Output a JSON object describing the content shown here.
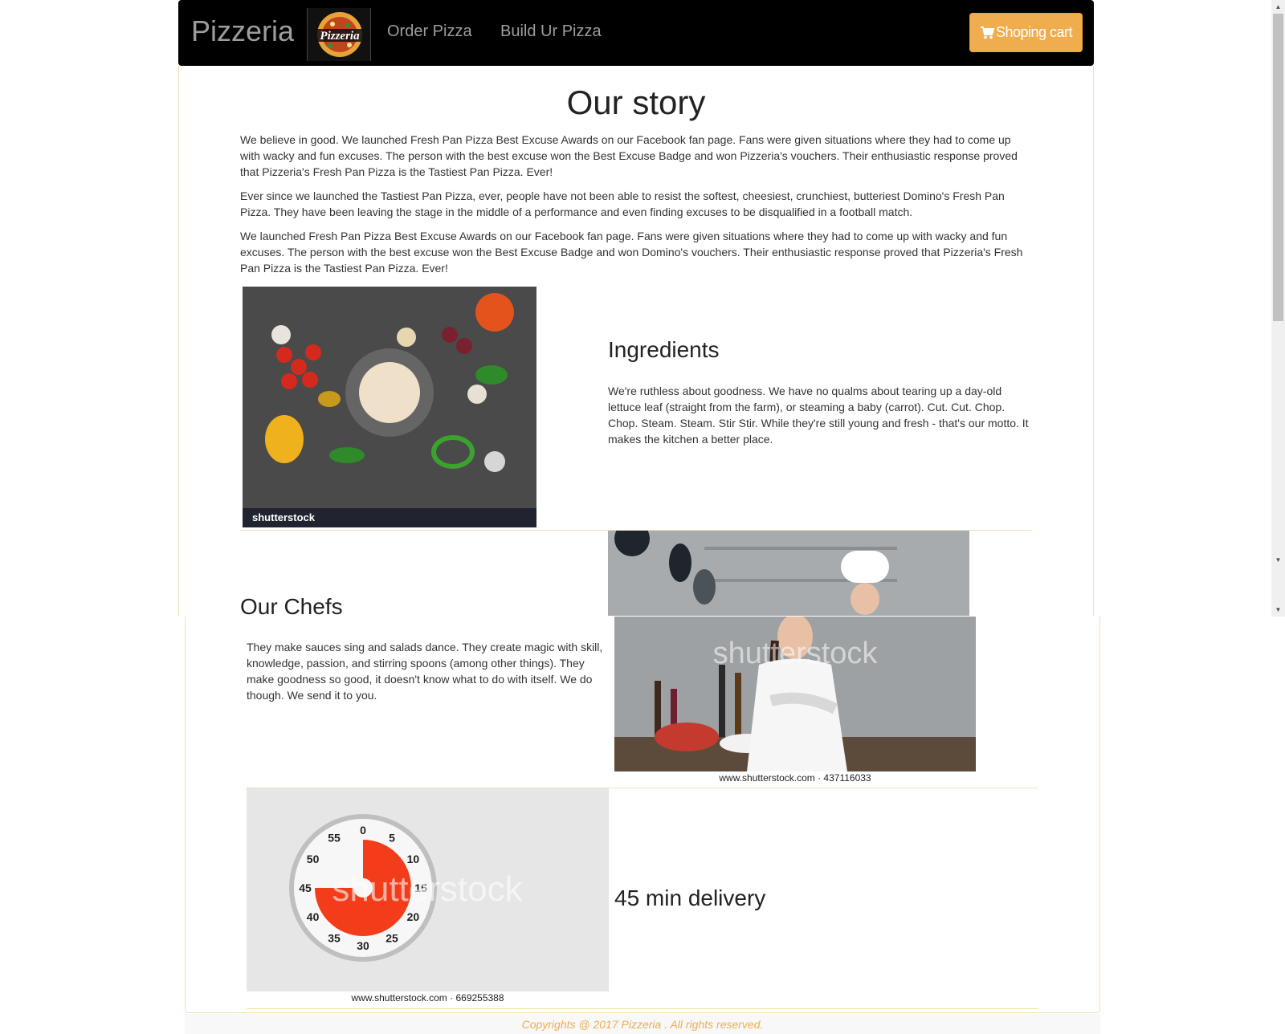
{
  "nav": {
    "brand": "Pizzeria",
    "logo_text": "Pizzeria",
    "links": [
      "Order Pizza",
      "Build Ur Pizza"
    ],
    "cart_label": "Shoping cart"
  },
  "story": {
    "title": "Our story",
    "paragraphs": [
      "We believe in good. We launched Fresh Pan Pizza Best Excuse Awards on our Facebook fan page. Fans were given situations where they had to come up with wacky and fun excuses. The person with the best excuse won the Best Excuse Badge and won Pizzeria's vouchers. Their enthusiastic response proved that Pizzeria's Fresh Pan Pizza is the Tastiest Pan Pizza. Ever!",
      "Ever since we launched the Tastiest Pan Pizza, ever, people have not been able to resist the softest, cheesiest, crunchiest, butteriest Domino's Fresh Pan Pizza. They have been leaving the stage in the middle of a performance and even finding excuses to be disqualified in a football match.",
      "We launched Fresh Pan Pizza Best Excuse Awards on our Facebook fan page. Fans were given situations where they had to come up with wacky and fun excuses. The person with the best excuse won the Best Excuse Badge and won Domino's vouchers. Their enthusiastic response proved that Pizzeria's Fresh Pan Pizza is the Tastiest Pan Pizza. Ever!"
    ]
  },
  "ingredients": {
    "heading": "Ingredients",
    "text": "We're ruthless about goodness. We have no qualms about tearing up a day-old lettuce leaf (straight from the farm), or steaming a baby (carrot). Cut. Cut. Chop. Chop. Steam. Steam. Stir Stir. While they're still young and fresh - that's our motto. It makes the kitchen a better place.",
    "image_watermark": "shutterstock"
  },
  "chefs": {
    "heading": "Our Chefs",
    "text": "They make sauces sing and salads dance. They create magic with skill, knowledge, passion, and stirring spoons (among other things). They make goodness so good, it doesn't know what to do with itself. We do though. We send it to you.",
    "caption": "www.shutterstock.com · 437116033",
    "watermark": "shutterstock"
  },
  "delivery": {
    "heading": "45 min delivery",
    "caption": "www.shutterstock.com · 669255388",
    "watermark": "shutterstock",
    "dial_numbers": [
      "0",
      "5",
      "10",
      "15",
      "20",
      "25",
      "30",
      "35",
      "40",
      "45",
      "50",
      "55"
    ]
  },
  "footer": {
    "text": "Copyrights @ 2017 Pizzeria . All rights reserved."
  },
  "colors": {
    "navbar_bg": "#000000",
    "accent": "#f0ad4e",
    "panel_border": "#f5deb3"
  }
}
